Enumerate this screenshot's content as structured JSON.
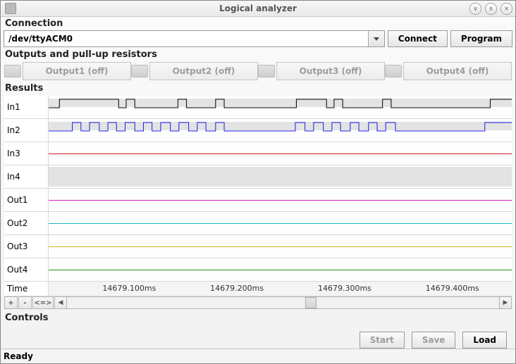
{
  "window": {
    "title": "Logical analyzer",
    "minimize_icon": "∨",
    "maximize_icon": "∧",
    "close_icon": "×"
  },
  "connection": {
    "title": "Connection",
    "port": "/dev/ttyACM0",
    "connect_btn": "Connect",
    "program_btn": "Program"
  },
  "outputs": {
    "title": "Outputs and pull-up resistors",
    "buttons": [
      "Output1 (off)",
      "Output2 (off)",
      "Output3 (off)",
      "Output4 (off)"
    ]
  },
  "results": {
    "title": "Results",
    "channels": [
      {
        "label": "In1",
        "color": "#000000",
        "type": "digital"
      },
      {
        "label": "In2",
        "color": "#1a1ae6",
        "type": "digital"
      },
      {
        "label": "In3",
        "color": "#d11919",
        "type": "flat"
      },
      {
        "label": "In4",
        "color": "#bdbdbd",
        "type": "band"
      },
      {
        "label": "Out1",
        "color": "#d11ecb",
        "type": "flat"
      },
      {
        "label": "Out2",
        "color": "#17b7bd",
        "type": "flat"
      },
      {
        "label": "Out3",
        "color": "#c9b21f",
        "type": "flat"
      },
      {
        "label": "Out4",
        "color": "#1f8f1f",
        "type": "flat"
      }
    ],
    "time_label": "Time",
    "time_ticks": [
      "14679.100ms",
      "14679.200ms",
      "14679.300ms",
      "14679.400ms"
    ]
  },
  "zoom": {
    "plus": "+",
    "minus": "-",
    "fit": "<=>"
  },
  "controls": {
    "title": "Controls",
    "start": "Start",
    "save": "Save",
    "load": "Load"
  },
  "status": "Ready",
  "chart_data": {
    "type": "digital-timing",
    "time_unit": "ms",
    "time_range_ms": [
      14679.05,
      14679.48
    ],
    "x_tick_ms": [
      14679.1,
      14679.2,
      14679.3,
      14679.4
    ],
    "signals": {
      "In1": {
        "level": "digital",
        "initial": 0,
        "transitions_ms": [
          [
            14679.06,
            1
          ],
          [
            14679.115,
            0
          ],
          [
            14679.122,
            1
          ],
          [
            14679.13,
            0
          ],
          [
            14679.17,
            1
          ],
          [
            14679.178,
            0
          ],
          [
            14679.205,
            1
          ],
          [
            14679.213,
            0
          ],
          [
            14679.28,
            1
          ],
          [
            14679.308,
            0
          ],
          [
            14679.315,
            1
          ],
          [
            14679.323,
            0
          ],
          [
            14679.36,
            1
          ],
          [
            14679.368,
            0
          ],
          [
            14679.46,
            1
          ]
        ]
      },
      "In2": {
        "level": "digital",
        "initial": 0,
        "transitions_ms": [
          [
            14679.072,
            1
          ],
          [
            14679.08,
            0
          ],
          [
            14679.088,
            1
          ],
          [
            14679.097,
            0
          ],
          [
            14679.105,
            1
          ],
          [
            14679.113,
            0
          ],
          [
            14679.121,
            1
          ],
          [
            14679.13,
            0
          ],
          [
            14679.138,
            1
          ],
          [
            14679.146,
            0
          ],
          [
            14679.154,
            1
          ],
          [
            14679.163,
            0
          ],
          [
            14679.171,
            1
          ],
          [
            14679.18,
            0
          ],
          [
            14679.188,
            1
          ],
          [
            14679.196,
            0
          ],
          [
            14679.205,
            1
          ],
          [
            14679.213,
            0
          ],
          [
            14679.279,
            1
          ],
          [
            14679.288,
            0
          ],
          [
            14679.296,
            1
          ],
          [
            14679.305,
            0
          ],
          [
            14679.313,
            1
          ],
          [
            14679.321,
            0
          ],
          [
            14679.33,
            1
          ],
          [
            14679.338,
            0
          ],
          [
            14679.347,
            1
          ],
          [
            14679.355,
            0
          ],
          [
            14679.363,
            1
          ],
          [
            14679.372,
            0
          ],
          [
            14679.455,
            1
          ]
        ]
      },
      "In3": {
        "level": "constant",
        "value": 0
      },
      "In4": {
        "level": "band",
        "value": null
      },
      "Out1": {
        "level": "constant",
        "value": 0
      },
      "Out2": {
        "level": "constant",
        "value": 0
      },
      "Out3": {
        "level": "constant",
        "value": 0
      },
      "Out4": {
        "level": "constant",
        "value": 0
      }
    }
  }
}
